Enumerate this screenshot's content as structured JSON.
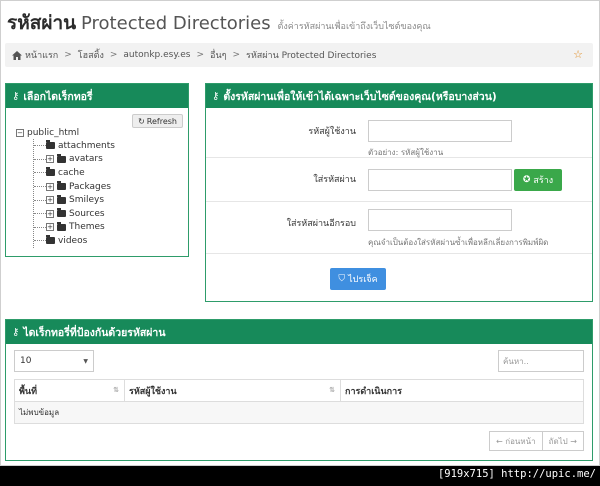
{
  "header": {
    "title_th": "รหัสผ่าน",
    "title_en": "Protected Directories",
    "subtitle": "ตั้งค่ารหัสผ่านเพื่อเข้าถึงเว็บไซต์ของคุณ"
  },
  "breadcrumb": {
    "items": [
      "หน้าแรก",
      "โฮสติ้ง",
      "autonkp.esy.es",
      "อื่นๆ",
      "รหัสผ่าน Protected Directories"
    ],
    "separator": ">",
    "home_icon": "home-icon",
    "star_icon": "star-icon"
  },
  "dir_panel": {
    "title": "เลือกไดเร็กทอรี่",
    "refresh_label": "Refresh",
    "root": "public_html",
    "children": [
      {
        "label": "attachments",
        "expandable": false
      },
      {
        "label": "avatars",
        "expandable": true
      },
      {
        "label": "cache",
        "expandable": false
      },
      {
        "label": "Packages",
        "expandable": true
      },
      {
        "label": "Smileys",
        "expandable": true
      },
      {
        "label": "Sources",
        "expandable": true
      },
      {
        "label": "Themes",
        "expandable": true
      },
      {
        "label": "videos",
        "expandable": false
      }
    ]
  },
  "pw_panel": {
    "title": "ตั้งรหัสผ่านเพื่อให้เข้าได้เฉพาะเว็บไซต์ของคุณ(หรือบางส่วน)",
    "username_label": "รหัสผู้ใช้งาน",
    "username_help": "ตัวอย่าง: รหัสผู้ใช้งาน",
    "password_label": "ใส่รหัสผ่าน",
    "create_label": "สร้าง",
    "confirm_label": "ใส่รหัสผ่านอีกรอบ",
    "confirm_help": "คุณจำเป็นต้องใส่รหัสผ่านซ้ำเพื่อหลีกเลี่ยงการพิมพ์ผิด",
    "submit_label": "ไปรเจ็ค"
  },
  "prot_panel": {
    "title": "ไดเร็กทอรี่ที่ป้องกันด้วยรหัสผ่าน",
    "page_length": "10",
    "search_placeholder": "ค้นหา..",
    "columns": [
      "พื้นที่",
      "รหัสผู้ใช้งาน",
      "การดำเนินการ"
    ],
    "empty_text": "ไม่พบข้อมูล",
    "prev_label": "← ก่อนหน้า",
    "next_label": "ถัดไป →"
  },
  "footer_tag": "[919x715] http://upic.me/",
  "colors": {
    "panel_header": "#178a5a",
    "create_button": "#3aa84a",
    "submit_button": "#3f8fe0",
    "star": "#e08a1e"
  }
}
